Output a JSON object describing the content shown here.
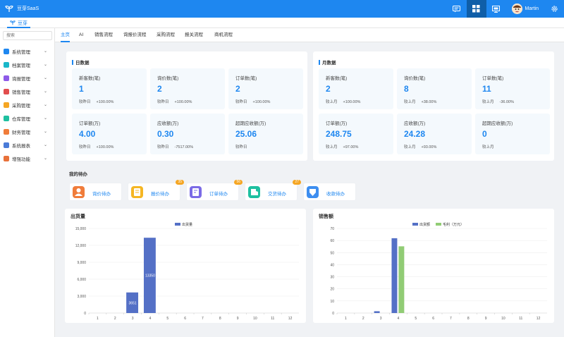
{
  "header": {
    "brand": "豆芽SaaS",
    "user_name": "Martin"
  },
  "subtab": {
    "label": "豆芽"
  },
  "sidebar": {
    "search_placeholder": "搜索",
    "items": [
      {
        "label": "系统管理",
        "color": "#1e87f0"
      },
      {
        "label": "档案管理",
        "color": "#19b7c9"
      },
      {
        "label": "询报管理",
        "color": "#8e5ae8"
      },
      {
        "label": "销售管理",
        "color": "#e24d4d"
      },
      {
        "label": "采购管理",
        "color": "#f5a623"
      },
      {
        "label": "仓库管理",
        "color": "#1ec0a0"
      },
      {
        "label": "财务管理",
        "color": "#f07c3a"
      },
      {
        "label": "系统报表",
        "color": "#4a7bd8"
      },
      {
        "label": "增强功能",
        "color": "#e8713a"
      }
    ]
  },
  "nav": {
    "tabs": [
      "主页",
      "AI",
      "销售流程",
      "询报价流程",
      "采购流程",
      "报关流程",
      "商机流程"
    ]
  },
  "daily": {
    "title": "日数据",
    "cards": [
      {
        "label": "新客数(笔)",
        "value": "1",
        "cmp": "较昨日",
        "pct": "+100.00%"
      },
      {
        "label": "询价数(笔)",
        "value": "2",
        "cmp": "较昨日",
        "pct": "+100.00%"
      },
      {
        "label": "订单数(笔)",
        "value": "2",
        "cmp": "较昨日",
        "pct": "+100.00%"
      },
      {
        "label": "订单额(万)",
        "value": "4.00",
        "cmp": "较昨日",
        "pct": "+100.00%"
      },
      {
        "label": "应收额(万)",
        "value": "0.30",
        "cmp": "较昨日",
        "pct": "-7517.00%"
      },
      {
        "label": "超期应收额(万)",
        "value": "25.06",
        "cmp": "较昨日",
        "pct": ""
      }
    ]
  },
  "monthly": {
    "title": "月数据",
    "cards": [
      {
        "label": "新客数(笔)",
        "value": "2",
        "cmp": "较上月",
        "pct": "+100.00%"
      },
      {
        "label": "询价数(笔)",
        "value": "8",
        "cmp": "较上月",
        "pct": "+38.00%"
      },
      {
        "label": "订单数(笔)",
        "value": "11",
        "cmp": "较上月",
        "pct": "-36.00%"
      },
      {
        "label": "订单额(万)",
        "value": "248.75",
        "cmp": "较上月",
        "pct": "+97.00%"
      },
      {
        "label": "应收额(万)",
        "value": "24.28",
        "cmp": "较上月",
        "pct": "+93.00%"
      },
      {
        "label": "超期应收额(万)",
        "value": "0",
        "cmp": "较上月",
        "pct": ""
      }
    ]
  },
  "todos": {
    "title": "我的待办",
    "items": [
      {
        "label": "询价待办",
        "badge": "",
        "color": "#f07c3a",
        "icon": "person-icon"
      },
      {
        "label": "报价待办",
        "badge": "35",
        "color": "#f5b623",
        "icon": "quote-icon"
      },
      {
        "label": "订单待办",
        "badge": "56",
        "color": "#7b6be6",
        "icon": "order-icon"
      },
      {
        "label": "交货待办",
        "badge": "27",
        "color": "#1ec0a0",
        "icon": "delivery-icon"
      },
      {
        "label": "收款待办",
        "badge": "",
        "color": "#3d8ef0",
        "icon": "payment-icon"
      }
    ]
  },
  "chart_data": [
    {
      "type": "bar",
      "title": "出货量",
      "categories": [
        "1",
        "2",
        "3",
        "4",
        "5",
        "6",
        "7",
        "8",
        "9",
        "10",
        "11",
        "12"
      ],
      "series": [
        {
          "name": "出货量",
          "values": [
            0,
            0,
            3651,
            13350,
            0,
            0,
            0,
            0,
            0,
            0,
            0,
            0
          ],
          "color": "#5470c6"
        }
      ],
      "ylim": [
        0,
        15000
      ],
      "yticks": [
        "0",
        "3,000",
        "6,000",
        "9,000",
        "12,000",
        "15,000"
      ],
      "data_labels": [
        "",
        "",
        "3651",
        "13350",
        "",
        "",
        "",
        "",
        "",
        "",
        "",
        ""
      ],
      "grid": true,
      "legend": "top-center"
    },
    {
      "type": "bar",
      "title": "销售额",
      "categories": [
        "1",
        "2",
        "3",
        "4",
        "5",
        "6",
        "7",
        "8",
        "9",
        "10",
        "11",
        "12"
      ],
      "series": [
        {
          "name": "出货额",
          "values": [
            0,
            0,
            1.5,
            61.9,
            0,
            0,
            0,
            0,
            0,
            0,
            0,
            0
          ],
          "color": "#5470c6"
        },
        {
          "name": "毛利（万元）",
          "values": [
            0,
            0,
            0,
            55.2,
            0,
            0,
            0,
            0,
            0,
            0,
            0,
            0
          ],
          "color": "#91cc75"
        }
      ],
      "ylim": [
        0,
        70
      ],
      "yticks": [
        "0",
        "10",
        "20",
        "30",
        "40",
        "50",
        "60",
        "70"
      ],
      "grid": true,
      "legend": "top-center"
    }
  ]
}
